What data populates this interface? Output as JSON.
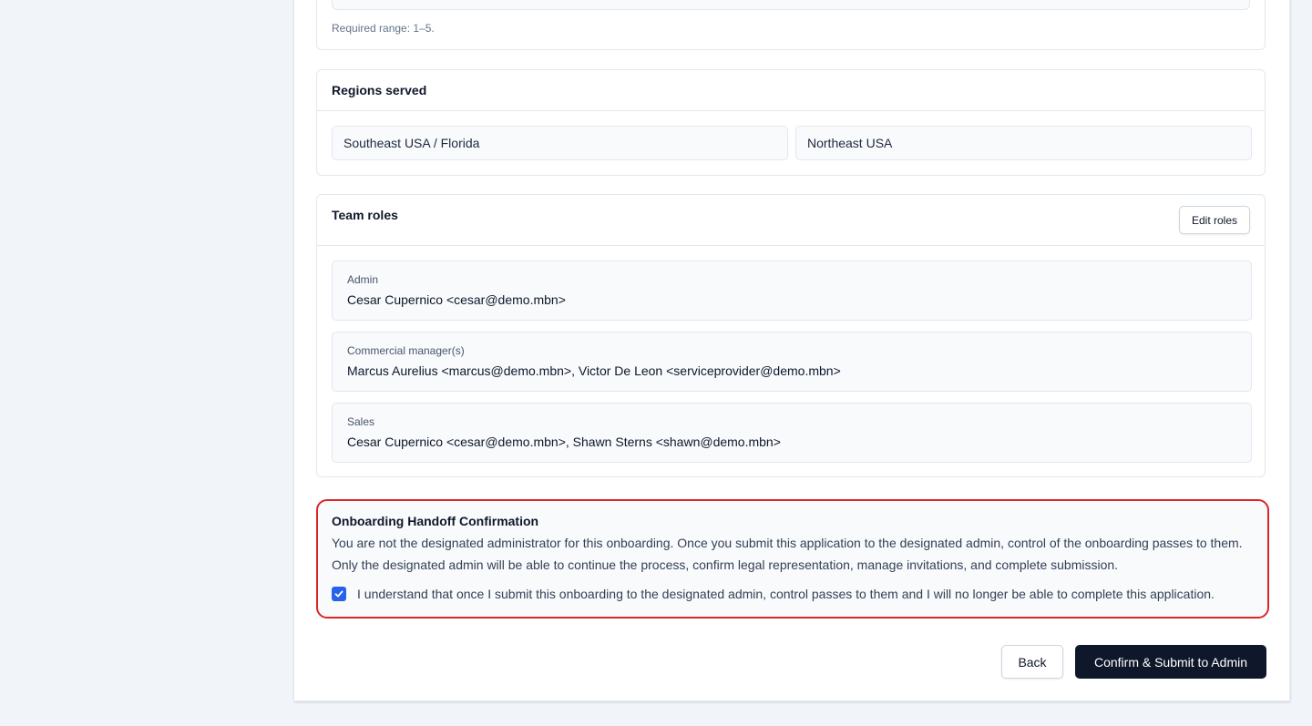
{
  "top_field": {
    "hint": "Required range: 1–5."
  },
  "regions": {
    "title": "Regions served",
    "items": [
      "Southeast USA / Florida",
      "Northeast USA"
    ]
  },
  "team_roles": {
    "title": "Team roles",
    "edit_label": "Edit roles",
    "roles": [
      {
        "label": "Admin",
        "value": "Cesar Cupernico <cesar@demo.mbn>"
      },
      {
        "label": "Commercial manager(s)",
        "value": "Marcus Aurelius <marcus@demo.mbn>, Victor De Leon <serviceprovider@demo.mbn>"
      },
      {
        "label": "Sales",
        "value": "Cesar Cupernico <cesar@demo.mbn>, Shawn Sterns <shawn@demo.mbn>"
      }
    ]
  },
  "handoff": {
    "title": "Onboarding Handoff Confirmation",
    "text": "You are not the designated administrator for this onboarding. Once you submit this application to the designated admin, control of the onboarding passes to them. Only the designated admin will be able to continue the process, confirm legal representation, manage invitations, and complete submission.",
    "checkbox_label": "I understand that once I submit this onboarding to the designated admin, control passes to them and I will no longer be able to complete this application.",
    "checked": true
  },
  "actions": {
    "back_label": "Back",
    "submit_label": "Confirm & Submit to Admin"
  },
  "colors": {
    "accent": "#2563eb",
    "primary_button": "#0f172a",
    "alert_border": "#dc2626"
  }
}
